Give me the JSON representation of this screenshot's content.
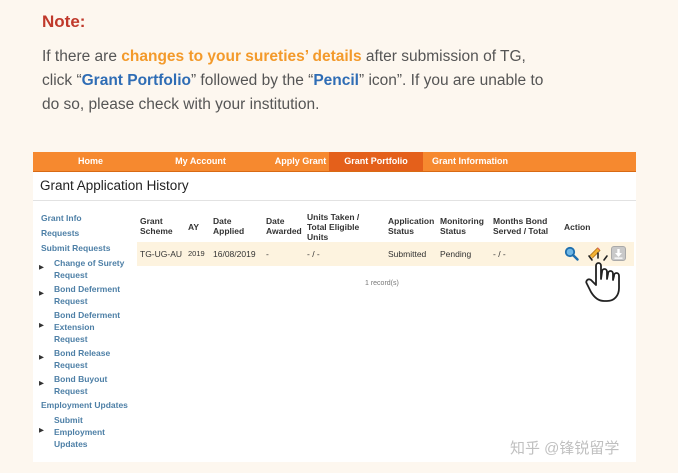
{
  "note": {
    "title": "Note:",
    "line1_a": "If there are ",
    "line1_hl": "changes to your sureties’ details",
    "line1_b": " after submission of TG,",
    "line2_a": "click “",
    "line2_hl1": "Grant Portfolio",
    "line2_b": "” followed by the “",
    "line2_hl2": "Pencil",
    "line2_c": "” icon”. If you are unable to",
    "line3": "do so, please check with your institution."
  },
  "nav": {
    "home": "Home",
    "my_account": "My Account",
    "apply_grant": "Apply Grant",
    "grant_portfolio": "Grant Portfolio",
    "grant_information": "Grant Information"
  },
  "page_title": "Grant Application History",
  "sidebar": {
    "grant_info": "Grant Info",
    "requests": "Requests",
    "submit_requests": "Submit Requests",
    "change_surety_1": "Change of Surety",
    "change_surety_2": "Request",
    "bond_deferment_1": "Bond Deferment",
    "bond_deferment_2": "Request",
    "bond_deferment_ext_1": "Bond Deferment",
    "bond_deferment_ext_2": "Extension",
    "bond_deferment_ext_3": "Request",
    "bond_release_1": "Bond Release",
    "bond_release_2": "Request",
    "bond_buyout_1": "Bond Buyout",
    "bond_buyout_2": "Request",
    "employment_updates": "Employment Updates",
    "submit_employment_1": "Submit",
    "submit_employment_2": "Employment",
    "submit_employment_3": "Updates"
  },
  "table": {
    "headers": {
      "grant_scheme_1": "Grant",
      "grant_scheme_2": "Scheme",
      "ay": "AY",
      "date_applied_1": "Date",
      "date_applied_2": "Applied",
      "date_awarded_1": "Date",
      "date_awarded_2": "Awarded",
      "units_1": "Units Taken /",
      "units_2": "Total Eligible",
      "units_3": "Units",
      "app_status_1": "Application",
      "app_status_2": "Status",
      "mon_status_1": "Monitoring",
      "mon_status_2": "Status",
      "months_bond_1": "Months Bond",
      "months_bond_2": "Served / Total",
      "action": "Action"
    },
    "row": {
      "grant_scheme": "TG-UG-AU",
      "ay": "2019",
      "date_applied": "16/08/2019",
      "date_awarded": "-",
      "units": "- / -",
      "application_status": "Submitted",
      "monitoring_status": "Pending",
      "months_bond": "- / -"
    },
    "records": "1 record(s)"
  },
  "watermark": "知乎 @锋锐留学",
  "icons": [
    "search-icon",
    "pencil-icon",
    "download-icon",
    "hand-pointer-icon",
    "chevron-right-icon"
  ],
  "colors": {
    "nav_orange": "#f6892f",
    "nav_active": "#e4601b",
    "note_red": "#c0392b",
    "highlight_orange": "#f39a2b",
    "highlight_blue": "#2f6db5",
    "row_highlight": "#fdf3df",
    "sidebar_link": "#4d7fa6"
  }
}
